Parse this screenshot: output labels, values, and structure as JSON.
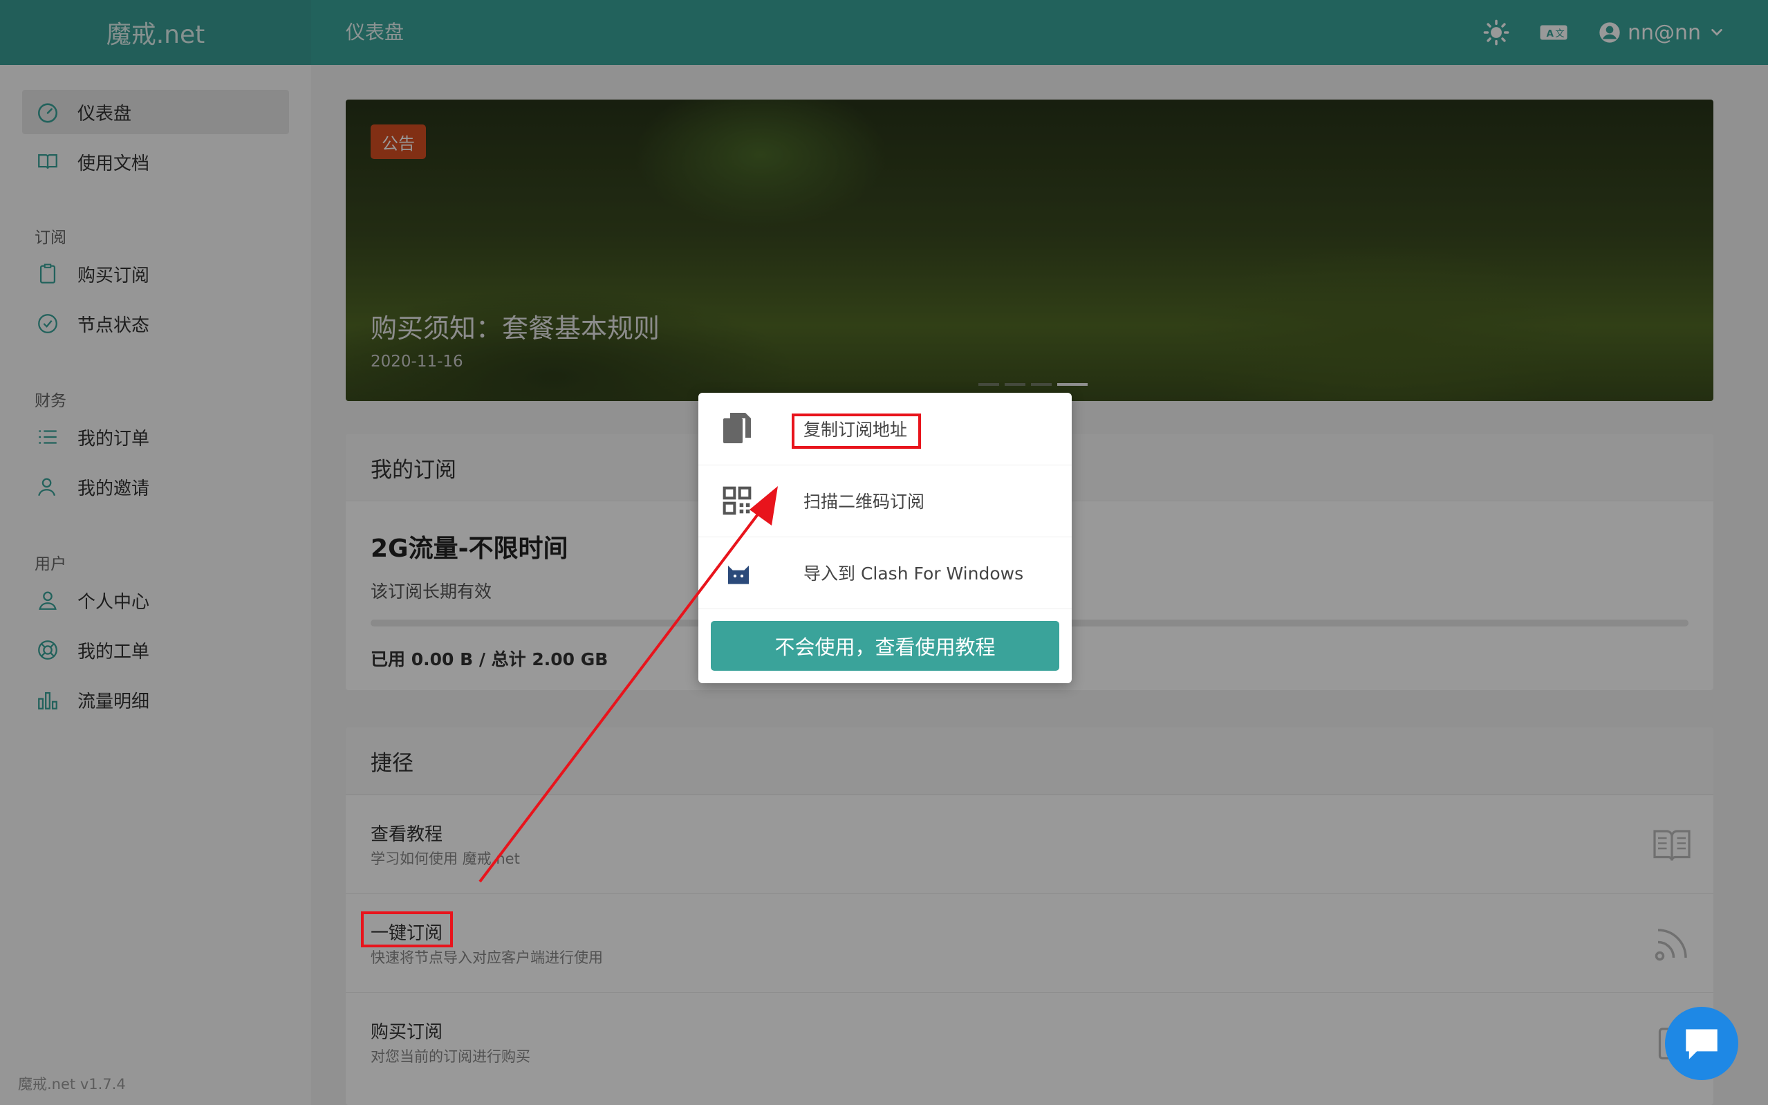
{
  "header": {
    "brand": "魔戒.net",
    "page_title": "仪表盘",
    "user": "nn@nn"
  },
  "sidebar": {
    "items": [
      {
        "label": "仪表盘"
      },
      {
        "label": "使用文档"
      },
      {
        "label": "购买订阅"
      },
      {
        "label": "节点状态"
      },
      {
        "label": "我的订单"
      },
      {
        "label": "我的邀请"
      },
      {
        "label": "个人中心"
      },
      {
        "label": "我的工单"
      },
      {
        "label": "流量明细"
      }
    ],
    "groups": [
      "订阅",
      "财务",
      "用户"
    ],
    "version": "魔戒.net v1.7.4"
  },
  "banner": {
    "badge": "公告",
    "title": "购买须知：套餐基本规则",
    "date": "2020-11-16"
  },
  "subscription": {
    "heading": "我的订阅",
    "plan_name": "2G流量-不限时间",
    "plan_desc": "该订阅长期有效",
    "usage": "已用 0.00 B / 总计 2.00 GB",
    "used_fraction": 0
  },
  "shortcuts": {
    "heading": "捷径",
    "items": [
      {
        "title": "查看教程",
        "desc": "学习如何使用 魔戒.net"
      },
      {
        "title": "一键订阅",
        "desc": "快速将节点导入对应客户端进行使用"
      },
      {
        "title": "购买订阅",
        "desc": "对您当前的订阅进行购买"
      }
    ]
  },
  "popup": {
    "items": [
      {
        "label": "复制订阅地址",
        "icon": "copy-icon"
      },
      {
        "label": "扫描二维码订阅",
        "icon": "qrcode-icon"
      },
      {
        "label": "导入到 Clash For Windows",
        "icon": "clash-cat-icon"
      }
    ],
    "button": "不会使用，查看使用教程"
  },
  "colors": {
    "accent": "#3aa39a",
    "badge": "#d84f22",
    "highlight": "#e8141c",
    "chat": "#1e88e5"
  }
}
